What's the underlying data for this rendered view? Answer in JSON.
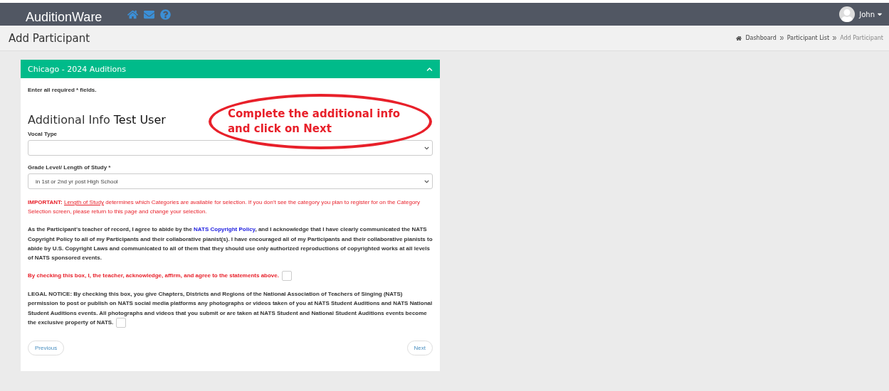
{
  "navbar": {
    "brand": "AuditionWare",
    "user": "John"
  },
  "page": {
    "title": "Add Participant",
    "breadcrumbs": [
      {
        "label": "Dashboard",
        "current": false
      },
      {
        "label": "Participant List",
        "current": false
      },
      {
        "label": "Add Participant",
        "current": true
      }
    ]
  },
  "panel": {
    "title": "Chicago - 2024 Auditions",
    "expanded": true,
    "required_note": "Enter all required * fields.",
    "heading": {
      "lead": "Additional Info",
      "name": "Test User"
    },
    "callout": "Complete the additional info and click on Next",
    "fields": [
      {
        "label": "Vocal Type"
      },
      {
        "label": "Grade Level/ Length of Study *",
        "value": "in 1st or 2nd yr post High School"
      }
    ],
    "important": {
      "lead": "IMPORTANT:",
      "term": "Length of Study",
      "text": " determines which Categories are available for selection. If you don't see the category you plan to register for on the Category Selection screen, please return to this page and change your selection."
    },
    "copyright": {
      "before": "As the Participant's teacher of record, I agree to abide by the ",
      "link": "NATS Copyright Policy",
      "after": ", and I acknowledge that I have clearly communicated the NATS Copyright Policy to all of my Participants and their collaborative pianist(s). I have encouraged all of my Participants and their collaborative pianists to abide by U.S. Copyright Laws and communicated to all of them that they should use only authorized reproductions of copyrighted works at all levels of NATS sponsored events."
    },
    "agreements": [
      {
        "kind": "warning",
        "text": "By checking this box, I, the teacher, acknowledge, affirm, and agree to the statements above.",
        "checked": false
      },
      {
        "kind": "notice",
        "text": "LEGAL NOTICE: By checking this box, you give Chapters, Districts and Regions of the National Association of Teachers of Singing (NATS) permission to post or publish on NATS social media platforms any photographs or videos taken of you at NATS Student Auditions and NATS National Student Auditions events. All photographs and videos that you submit or are taken at NATS Student and National Student Auditions events become the exclusive property of NATS.",
        "checked": false
      }
    ],
    "buttons": [
      {
        "label": "Previous"
      },
      {
        "label": "Next"
      }
    ]
  }
}
